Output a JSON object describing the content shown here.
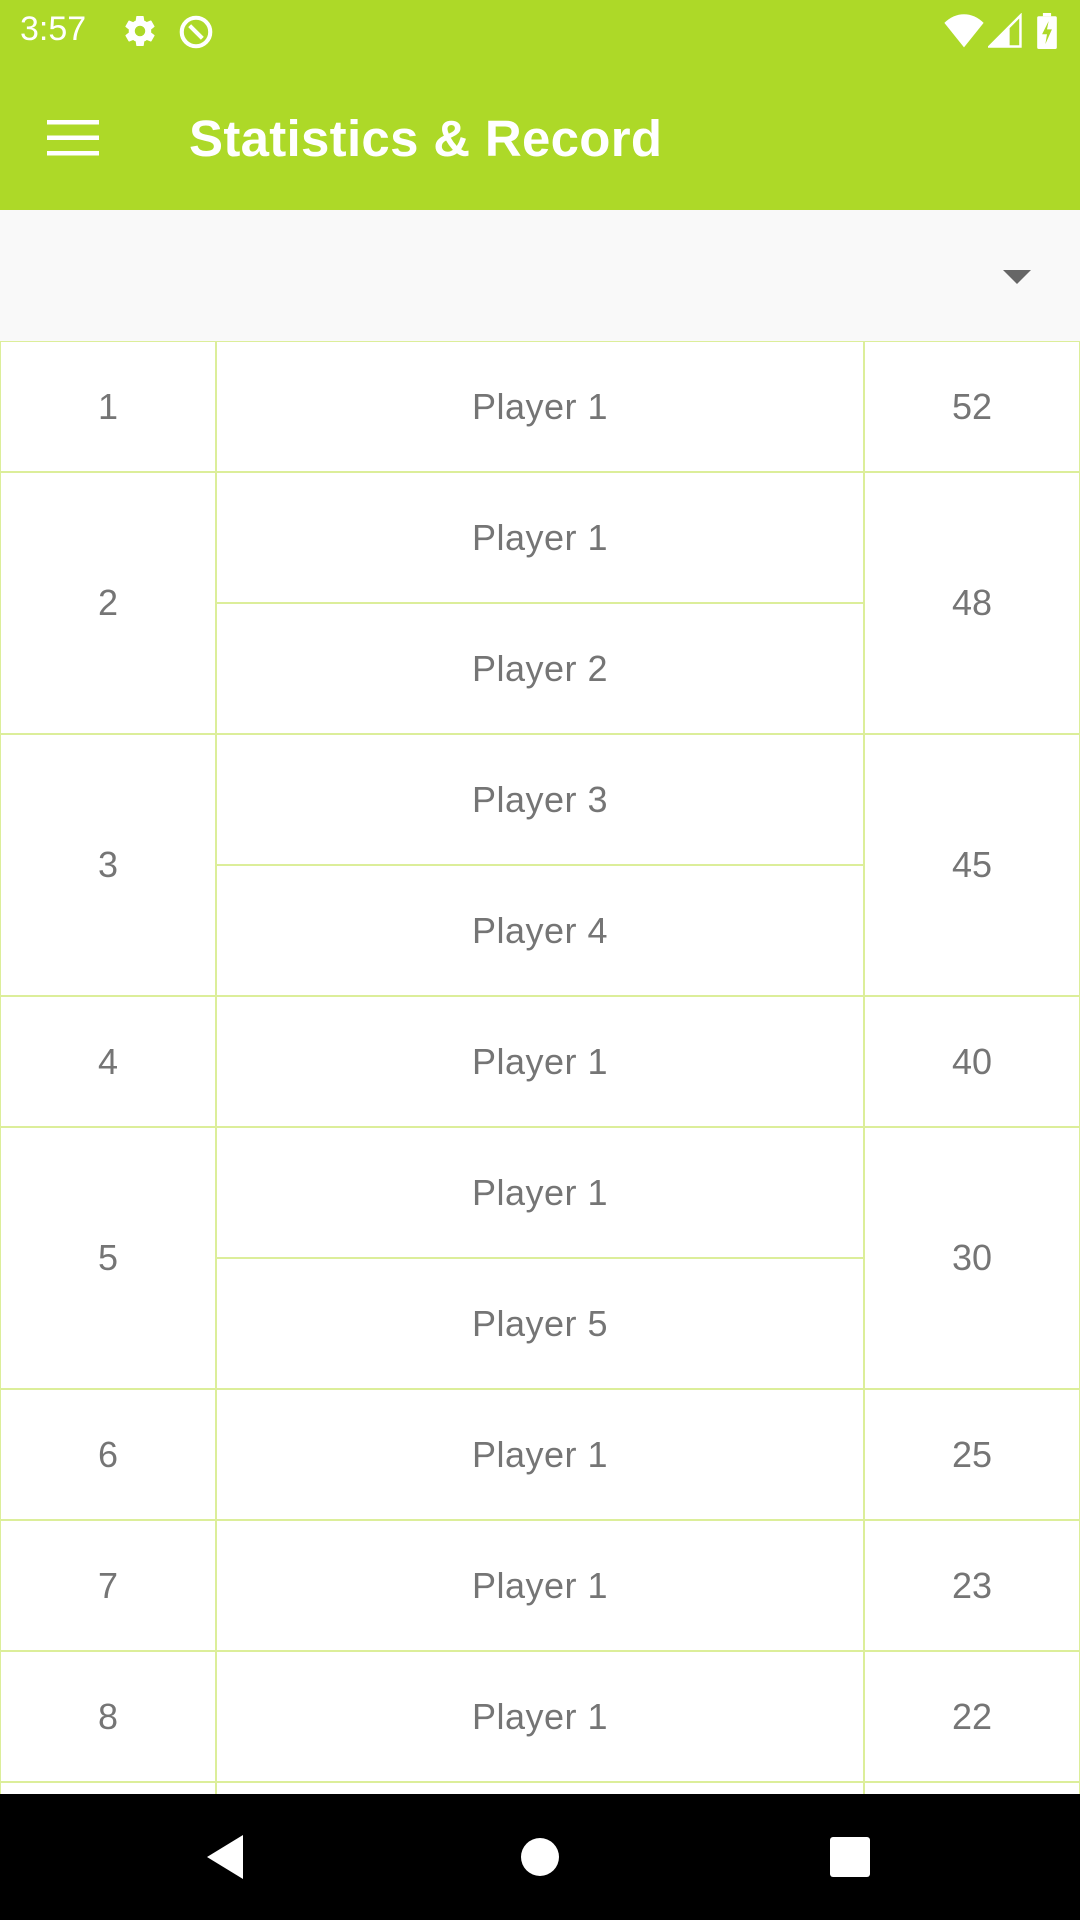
{
  "status_bar": {
    "time": "3:57",
    "icons_left": [
      "gear-icon",
      "no-disturb-icon"
    ],
    "icons_right": [
      "wifi-icon",
      "signal-icon",
      "battery-icon"
    ]
  },
  "app_bar": {
    "title": "Statistics & Record",
    "menu_icon": "hamburger-menu-icon",
    "color": "#add928"
  },
  "filter": {
    "selected_value": "",
    "icon": "dropdown-arrow-icon"
  },
  "table": {
    "rows": [
      {
        "rank": "1",
        "players": [
          "Player 1"
        ],
        "score": "52"
      },
      {
        "rank": "2",
        "players": [
          "Player 1",
          "Player 2"
        ],
        "score": "48"
      },
      {
        "rank": "3",
        "players": [
          "Player 3",
          "Player 4"
        ],
        "score": "45"
      },
      {
        "rank": "4",
        "players": [
          "Player 1"
        ],
        "score": "40"
      },
      {
        "rank": "5",
        "players": [
          "Player 1",
          "Player 5"
        ],
        "score": "30"
      },
      {
        "rank": "6",
        "players": [
          "Player 1"
        ],
        "score": "25"
      },
      {
        "rank": "7",
        "players": [
          "Player 1"
        ],
        "score": "23"
      },
      {
        "rank": "8",
        "players": [
          "Player 1"
        ],
        "score": "22"
      },
      {
        "rank": "",
        "players": [
          ""
        ],
        "score": ""
      }
    ]
  },
  "nav_bar": {
    "buttons": [
      "back-icon",
      "home-icon",
      "recents-icon"
    ]
  }
}
